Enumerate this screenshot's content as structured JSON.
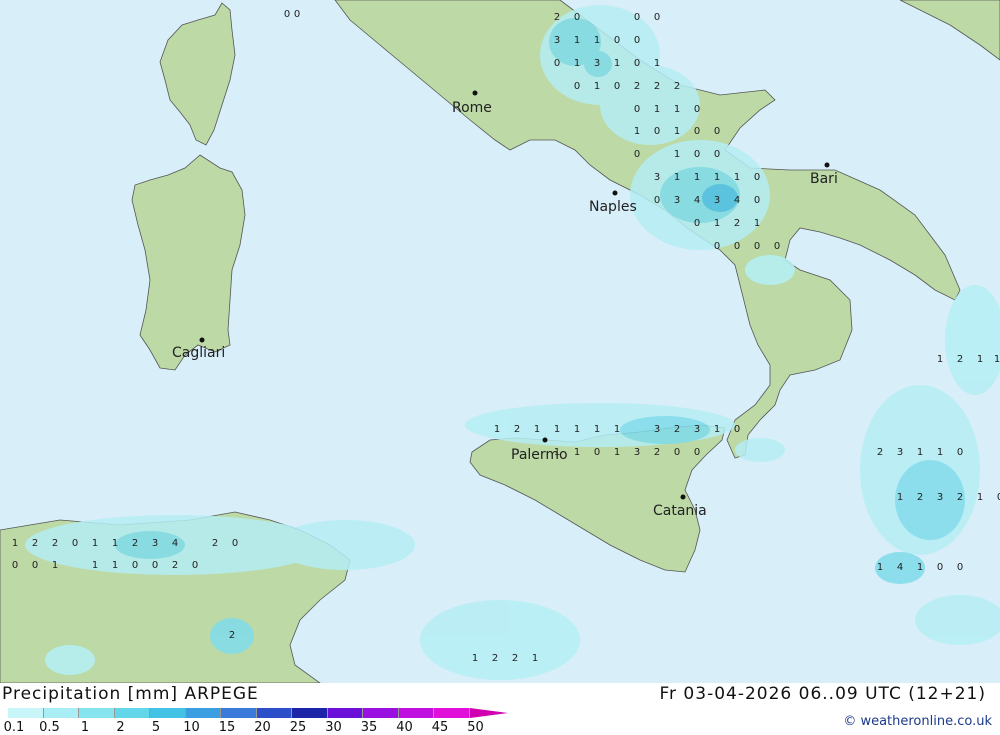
{
  "title": "Precipitation [mm] ARPEGE",
  "validity": "Fr 03-04-2026 06..09 UTC (12+21)",
  "credit": "© weatheronline.co.uk",
  "colors": {
    "sea": "#d8eef8",
    "land": "#bcd9a6",
    "precip_light": "#b5eef4",
    "precip_mid": "#7fdcec",
    "precip_strong": "#4cc0e8"
  },
  "legend": {
    "ticks": [
      "0.1",
      "0.5",
      "1",
      "2",
      "5",
      "10",
      "15",
      "20",
      "25",
      "30",
      "35",
      "40",
      "45",
      "50"
    ],
    "colors": [
      "#c8f6f8",
      "#a8eef4",
      "#86e4ee",
      "#64d6ea",
      "#44c2e6",
      "#3a9ee0",
      "#3a7ad8",
      "#2c4ec8",
      "#1c24a8",
      "#6a10d8",
      "#9a10e0",
      "#c010e0",
      "#e010d8",
      "#d000b0"
    ]
  },
  "cities": [
    {
      "name": "Rome",
      "id": "rome"
    },
    {
      "name": "Naples",
      "id": "naples"
    },
    {
      "name": "Bari",
      "id": "bari"
    },
    {
      "name": "Cagliari",
      "id": "cagliari"
    },
    {
      "name": "Palermo",
      "id": "palermo"
    },
    {
      "name": "Catania",
      "id": "catania"
    }
  ],
  "values": [
    [
      "2",
      "0",
      "0",
      "0",
      "0",
      "0"
    ],
    [
      "3",
      "1",
      "1",
      "0",
      "0"
    ],
    [
      "0",
      "1",
      "3",
      "1",
      "0",
      "1"
    ],
    [
      "0",
      "1",
      "0",
      "2",
      "2",
      "2"
    ],
    [
      "0",
      "1",
      "1",
      "0"
    ],
    [
      "1",
      "0",
      "1",
      "0",
      "0"
    ],
    [
      "0",
      "1",
      "0",
      "0"
    ],
    [
      "3",
      "1",
      "1",
      "1",
      "1",
      "0"
    ],
    [
      "0",
      "3",
      "4",
      "3",
      "4",
      "0"
    ],
    [
      "0",
      "1",
      "2",
      "1"
    ],
    [
      "0",
      "0",
      "0",
      "0"
    ],
    [
      "1",
      "2",
      "1",
      "1",
      "1",
      "1",
      "1",
      "3",
      "2",
      "3",
      "1",
      "0"
    ],
    [
      "0",
      "1",
      "1",
      "1",
      "3",
      "2",
      "0",
      "0"
    ],
    [
      "1",
      "2",
      "2",
      "0",
      "1",
      "1",
      "2",
      "3",
      "4",
      "2",
      "0"
    ],
    [
      "0",
      "0",
      "1",
      "1",
      "1",
      "0",
      "0",
      "2",
      "0"
    ],
    [
      "2"
    ],
    [
      "1",
      "2",
      "2",
      "1"
    ],
    [
      "1",
      "2",
      "3",
      "2",
      "1",
      "0"
    ],
    [
      "1",
      "4",
      "1",
      "0",
      "0"
    ],
    [
      "2",
      "3",
      "1",
      "1",
      "0"
    ],
    [
      "1",
      "2",
      "1",
      "1"
    ]
  ]
}
